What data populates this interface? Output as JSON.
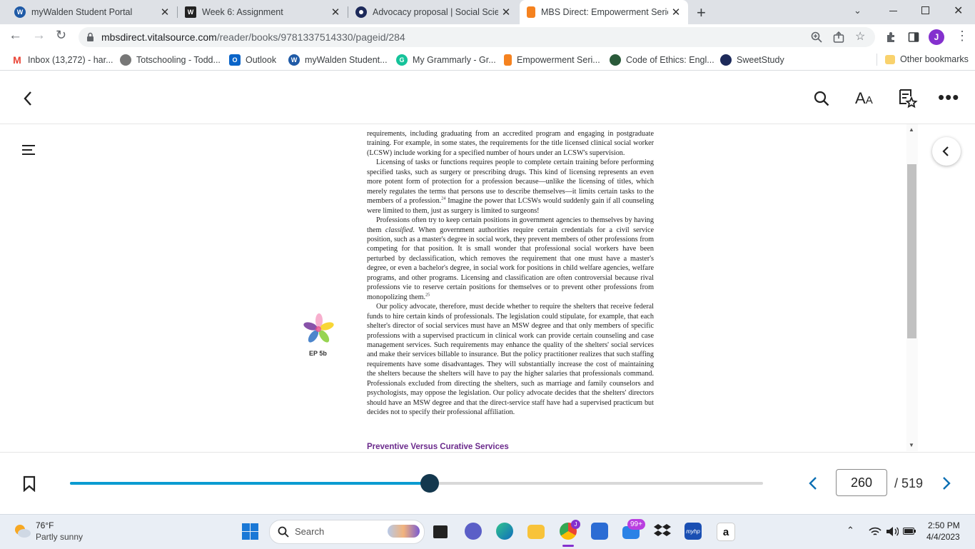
{
  "browser": {
    "tabs": [
      {
        "title": "myWalden Student Portal",
        "icon": "walden-icon",
        "color": "#1f5aa6",
        "letter": "W"
      },
      {
        "title": "Week 6: Assignment",
        "icon": "walden-w-icon",
        "color": "#222222",
        "letter": "W"
      },
      {
        "title": "Advocacy proposal | Social Scienc",
        "icon": "sweetstudy-icon",
        "color": "#1d2a5a",
        "letter": ""
      },
      {
        "title": "MBS Direct: Empowerment Series",
        "icon": "mbs-icon",
        "color": "#f5821f",
        "letter": ""
      }
    ],
    "url_host": "mbsdirect.vitalsource.com",
    "url_path": "/reader/books/9781337514330/pageid/284",
    "profile_letter": "J",
    "bookmarks": [
      {
        "label": "Inbox (13,272) - har...",
        "icon": "gmail-icon",
        "color": "#ea4335",
        "letter": "M"
      },
      {
        "label": "Totschooling - Todd...",
        "icon": "totschooling-icon",
        "color": "#555555",
        "letter": ""
      },
      {
        "label": "Outlook",
        "icon": "outlook-icon",
        "color": "#0a64c8",
        "letter": "O"
      },
      {
        "label": "myWalden Student...",
        "icon": "walden-icon",
        "color": "#1f5aa6",
        "letter": "W"
      },
      {
        "label": "My Grammarly - Gr...",
        "icon": "grammarly-icon",
        "color": "#15c39a",
        "letter": "G"
      },
      {
        "label": "Empowerment Seri...",
        "icon": "mbs-icon",
        "color": "#f5821f",
        "letter": ""
      },
      {
        "label": "Code of Ethics: Engl...",
        "icon": "nasw-icon",
        "color": "#2a5a3a",
        "letter": ""
      },
      {
        "label": "SweetStudy",
        "icon": "sweetstudy-icon",
        "color": "#1d2a5a",
        "letter": ""
      }
    ],
    "other_bookmarks": "Other bookmarks"
  },
  "reader": {
    "margin_label": "EP 5b",
    "paragraphs": [
      "requirements, including graduating from an accredited program and engaging in postgraduate training. For example, in some states, the requirements for the title licensed clinical social worker (LCSW) include working for a specified number of hours under an LCSW's supervision.",
      "Licensing of tasks or functions requires people to complete certain training before performing specified tasks, such as surgery or prescribing drugs. This kind of licensing represents an even more potent form of protection for a profession because—unlike the licensing of titles, which merely regulates the terms that persons use to describe themselves—it limits certain tasks to the members of a profession.",
      "Imagine the power that LCSWs would suddenly gain if all counseling were limited to them, just as surgery is limited to surgeons!",
      "Professions often try to keep certain positions in government agencies to themselves by having them",
      "classified",
      ". When government authorities require certain credentials for a civil service position, such as a master's degree in social work, they prevent members of other professions from competing for that position. It is small wonder that professional social workers have been perturbed by declassification, which removes the requirement that one must have a master's degree, or even a bachelor's degree, in social work for positions in child welfare agencies, welfare programs, and other programs. Licensing and classification are often controversial because rival professions vie to reserve certain positions for themselves or to prevent other professions from monopolizing them.",
      "Our policy advocate, therefore, must decide whether to require the shelters that receive federal funds to hire certain kinds of professionals. The legislation could stipulate, for example, that each shelter's director of social services must have an MSW degree and that only members of specific professions with a supervised practicum in clinical work can provide certain counseling and case management services. Such requirements may enhance the quality of the shelters' social services and make their services billable to insurance. But the policy practitioner realizes that such staffing requirements have some disadvantages. They will substantially increase the cost of maintaining the shelters because the shelters will have to pay the higher salaries that professionals command. Professionals excluded from directing the shelters, such as marriage and family counselors and psychologists, may oppose the legislation. Our policy advocate decides that the shelters' directors should have an MSW degree and that the direct-service staff have had a supervised practicum but decides not to specify their professional affiliation."
    ],
    "footnote_24": "24",
    "footnote_25": "25",
    "section_heading": "Preventive Versus Curative Services",
    "current_page": "260",
    "total_pages": "/ 519",
    "progress": 0.519,
    "accent": "#0a9bd1"
  },
  "taskbar": {
    "temp": "76°F",
    "weather": "Partly sunny",
    "search": "Search",
    "mail_badge": "99+",
    "time": "2:50 PM",
    "date": "4/4/2023"
  }
}
